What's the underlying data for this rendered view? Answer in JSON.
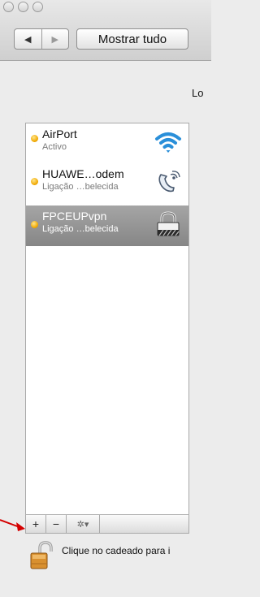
{
  "toolbar": {
    "show_all_label": "Mostrar tudo",
    "back_symbol": "◀",
    "forward_symbol": "▶"
  },
  "location_label": "Lo",
  "services": [
    {
      "name": "AirPort",
      "status": "Activo",
      "icon": "wifi-icon",
      "selected": false
    },
    {
      "name": "HUAWE…odem",
      "status": "Ligação …belecida",
      "icon": "phone-modem-icon",
      "selected": false
    },
    {
      "name": "FPCEUPvpn",
      "status": "Ligação …belecida",
      "icon": "vpn-lock-icon",
      "selected": true
    }
  ],
  "list_actions": {
    "add": "+",
    "remove": "−",
    "gear": "✲▾"
  },
  "lock_message": "Clique no cadeado para i",
  "colors": {
    "status_dot": "#f0a800",
    "arrow": "#d40000",
    "wifi": "#2a8fd9"
  }
}
